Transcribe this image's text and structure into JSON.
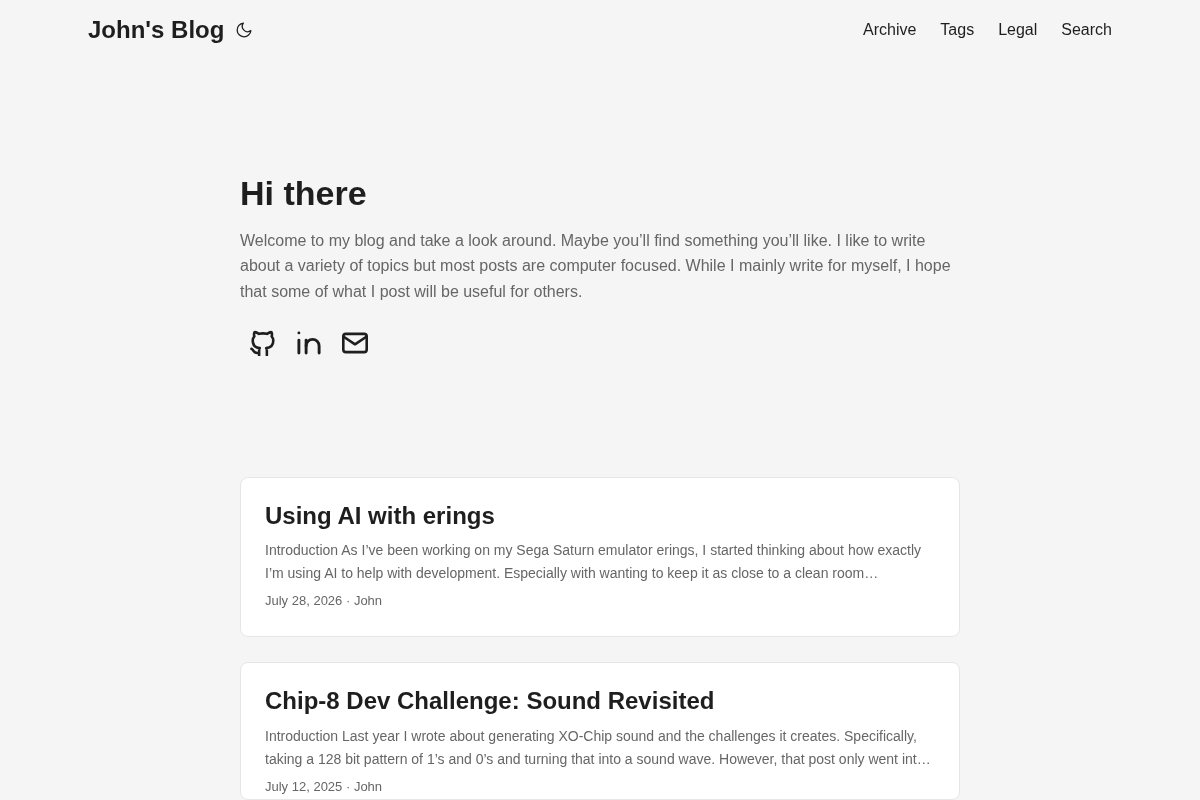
{
  "header": {
    "title": "John's Blog",
    "nav": [
      "Archive",
      "Tags",
      "Legal",
      "Search"
    ]
  },
  "hero": {
    "title": "Hi there",
    "text": "Welcome to my blog and take a look around. Maybe you’ll find something you’ll like. I like to write about a variety of topics but most posts are computer focused. While I mainly write for myself, I hope that some of what I post will be useful for others.",
    "social": [
      {
        "kind": "github"
      },
      {
        "kind": "linkedin"
      },
      {
        "kind": "email"
      }
    ]
  },
  "posts": [
    {
      "title": "Using AI with erings",
      "summary": "Introduction As I’ve been working on my Sega Saturn emulator erings, I started thinking about how exactly I’m using AI to help with development. Especially with wanting to keep it as close to a clean room…",
      "meta": "July 28, 2026 · John"
    },
    {
      "title": "Chip-8 Dev Challenge: Sound Revisited",
      "summary": "Introduction Last year I wrote about generating XO-Chip sound and the challenges it creates. Specifically, taking a 128 bit pattern of 1’s and 0’s and turning that into a sound wave. However, that post only went int…",
      "meta": "July 12, 2025 · John"
    }
  ]
}
